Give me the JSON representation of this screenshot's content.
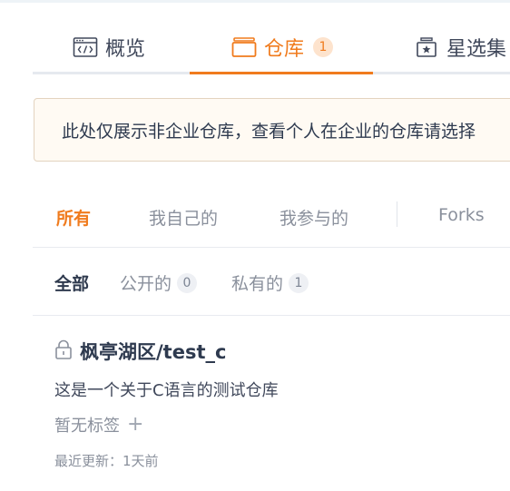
{
  "tabs": {
    "overview": {
      "label": "概览",
      "icon": "code-window-icon"
    },
    "repos": {
      "label": "仓库",
      "icon": "repo-box-icon",
      "count": "1"
    },
    "stars": {
      "label": "星选集",
      "icon": "star-collection-icon"
    }
  },
  "notice": {
    "text": "此处仅展示非企业仓库，查看个人在企业的仓库请选择"
  },
  "filters": {
    "all": "所有",
    "mine": "我自己的",
    "joined": "我参与的",
    "forks": "Forks"
  },
  "subfilters": {
    "all": "全部",
    "public": {
      "label": "公开的",
      "count": "0"
    },
    "private": {
      "label": "私有的",
      "count": "1"
    }
  },
  "repo": {
    "name": "枫亭湖区/test_c",
    "description": "这是一个关于C语言的测试仓库",
    "tags_placeholder": "暂无标签",
    "add_tag": "+",
    "updated": "最近更新：1天前"
  },
  "colors": {
    "accent": "#f07b1d",
    "text": "#40485b",
    "muted": "#8a909c"
  }
}
